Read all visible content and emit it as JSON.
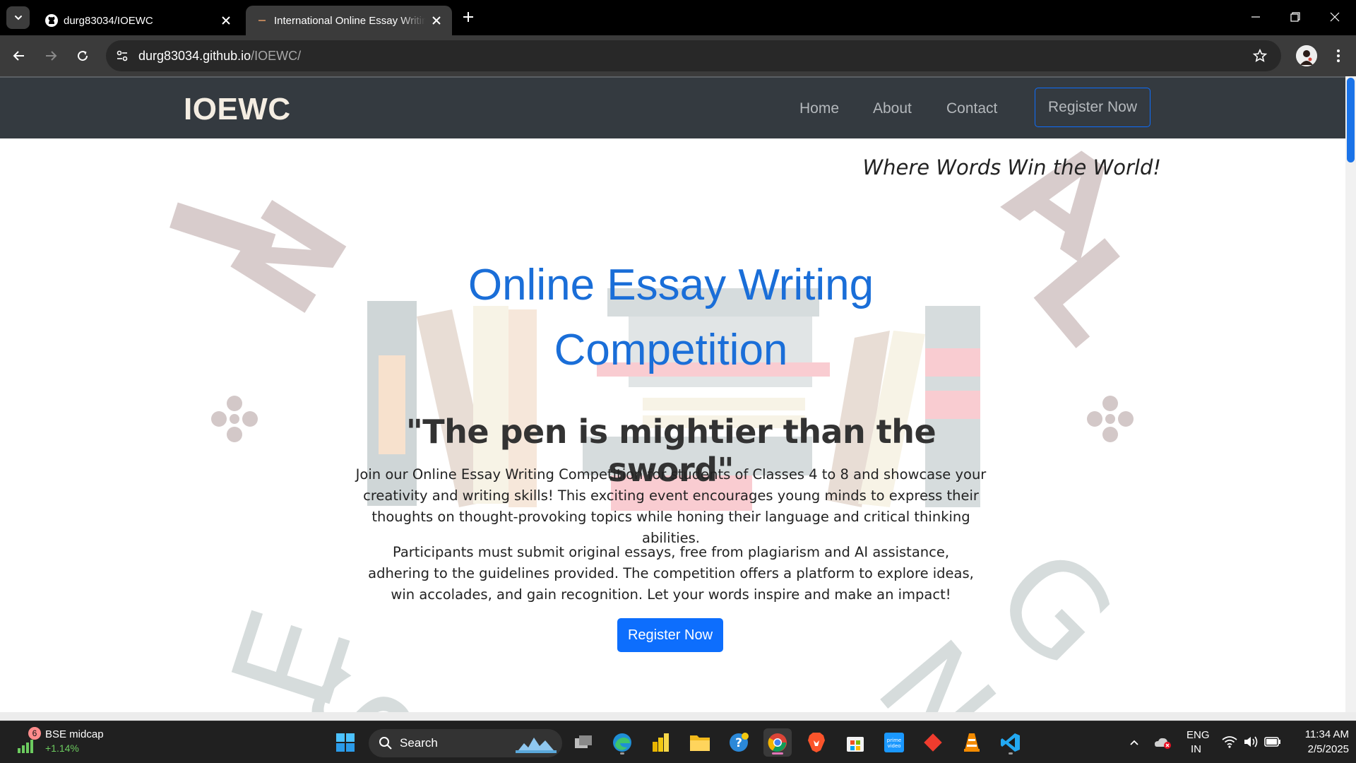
{
  "browser": {
    "tabs": [
      {
        "title": "durg83034/IOEWC",
        "icon": "github-icon",
        "active": false
      },
      {
        "title": "International Online Essay Writing Competition",
        "icon": "site-favicon",
        "active": true
      }
    ],
    "url_host": "durg83034.github.io",
    "url_path": "/IOEWC/"
  },
  "site": {
    "brand": "IOEWC",
    "nav": {
      "home": "Home",
      "about": "About",
      "contact": "Contact",
      "register": "Register Now"
    },
    "tagline": "Where Words Win the World!",
    "hero": {
      "title": "Online Essay Writing Competition",
      "quote": "\"The pen is mightier than the sword\"",
      "paragraph1": "Join our Online Essay Writing Competition for students of Classes 4 to 8 and showcase your creativity and writing skills! This exciting event encourages young minds to express their thoughts on thought-provoking topics while honing their language and critical thinking abilities.",
      "paragraph2": "Participants must submit original essays, free from plagiarism and AI assistance, adhering to the guidelines provided. The competition offers a platform to explore ideas, win accolades, and gain recognition. Let your words inspire and make an impact!",
      "cta": "Register Now"
    },
    "colors": {
      "nav_bg": "#343a40",
      "accent": "#0d6efd",
      "title_blue": "#1a6ed8"
    }
  },
  "taskbar": {
    "widget": {
      "badge": "6",
      "title": "BSE midcap",
      "value": "+1.14%"
    },
    "search_label": "Search",
    "tray": {
      "lang": "ENG",
      "region": "IN"
    },
    "clock": {
      "time": "11:34 AM",
      "date": "2/5/2025"
    },
    "apps": [
      "start-icon",
      "search-icon",
      "task-view-icon",
      "edge-icon",
      "power-bi-icon",
      "file-explorer-icon",
      "help-icon",
      "chrome-icon",
      "brave-icon",
      "microsoft-store-icon",
      "prime-video-icon",
      "git-icon",
      "vlc-icon",
      "vscode-icon"
    ]
  }
}
